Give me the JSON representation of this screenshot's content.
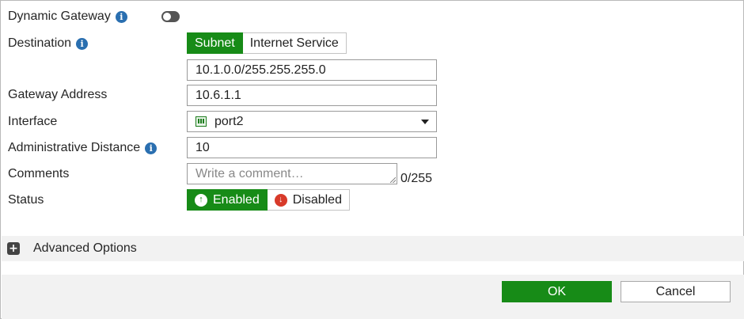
{
  "form": {
    "dynamic_gateway": {
      "label": "Dynamic Gateway",
      "enabled": false
    },
    "destination": {
      "label": "Destination",
      "options": [
        "Subnet",
        "Internet Service"
      ],
      "selected": "Subnet",
      "value": "10.1.0.0/255.255.255.0"
    },
    "gateway_address": {
      "label": "Gateway Address",
      "value": "10.6.1.1"
    },
    "interface": {
      "label": "Interface",
      "value": "port2",
      "icon": "port-icon"
    },
    "administrative_distance": {
      "label": "Administrative Distance",
      "value": "10"
    },
    "comments": {
      "label": "Comments",
      "placeholder": "Write a comment…",
      "counter": "0/255"
    },
    "status": {
      "label": "Status",
      "enabled_label": "Enabled",
      "disabled_label": "Disabled",
      "selected": "Enabled"
    }
  },
  "advanced": {
    "label": "Advanced Options"
  },
  "footer": {
    "ok_label": "OK",
    "cancel_label": "Cancel"
  },
  "colors": {
    "accent": "#178b17",
    "info": "#2a6fb0",
    "disabled_icon": "#d83a2a"
  }
}
